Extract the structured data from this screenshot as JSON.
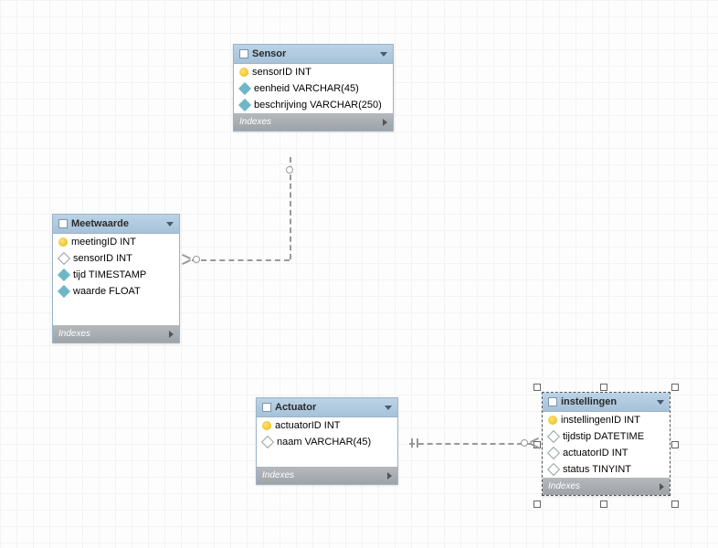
{
  "entities": {
    "sensor": {
      "title": "Sensor",
      "columns": [
        {
          "icon": "key",
          "text": "sensorID INT"
        },
        {
          "icon": "diamond-fill",
          "text": "eenheid VARCHAR(45)"
        },
        {
          "icon": "diamond-fill",
          "text": "beschrijving VARCHAR(250)"
        }
      ],
      "footer": "Indexes"
    },
    "meetwaarde": {
      "title": "Meetwaarde",
      "columns": [
        {
          "icon": "key",
          "text": "meetingID INT"
        },
        {
          "icon": "diamond-outline",
          "text": "sensorID INT"
        },
        {
          "icon": "diamond-fill",
          "text": "tijd TIMESTAMP"
        },
        {
          "icon": "diamond-fill",
          "text": "waarde FLOAT"
        }
      ],
      "footer": "Indexes"
    },
    "actuator": {
      "title": "Actuator",
      "columns": [
        {
          "icon": "key",
          "text": "actuatorID INT"
        },
        {
          "icon": "diamond-outline",
          "text": "naam VARCHAR(45)"
        }
      ],
      "footer": "Indexes"
    },
    "instellingen": {
      "title": "instellingen",
      "columns": [
        {
          "icon": "key",
          "text": "instellingenID INT"
        },
        {
          "icon": "diamond-outline",
          "text": "tijdstip DATETIME"
        },
        {
          "icon": "diamond-outline",
          "text": "actuatorID INT"
        },
        {
          "icon": "diamond-outline",
          "text": "status TINYINT"
        }
      ],
      "footer": "Indexes"
    }
  },
  "relationships": [
    {
      "from": "meetwaarde",
      "to": "sensor",
      "cardinality": "many-to-one-optional"
    },
    {
      "from": "instellingen",
      "to": "actuator",
      "cardinality": "many-to-one"
    }
  ]
}
